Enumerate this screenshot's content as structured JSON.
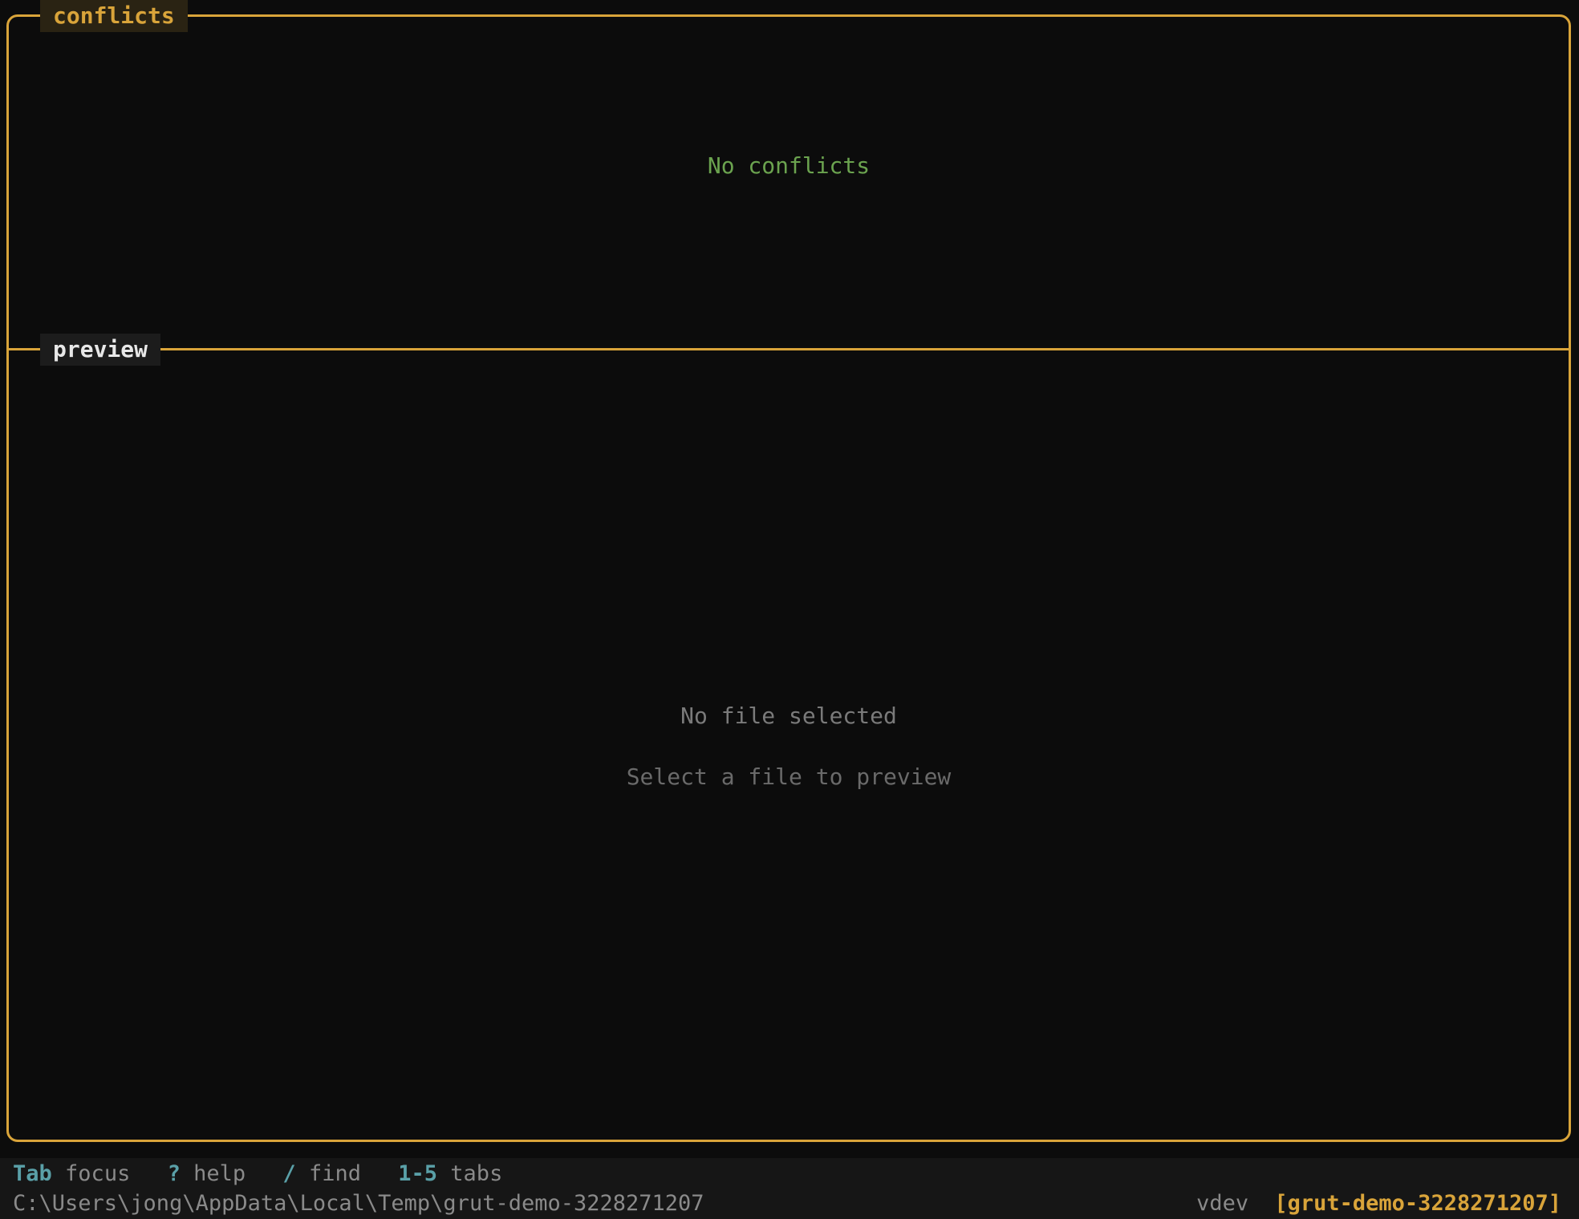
{
  "conflicts_panel": {
    "title": "conflicts",
    "empty_message": "No conflicts"
  },
  "preview_panel": {
    "title": "preview",
    "empty_message": "No file selected",
    "hint": "Select a file to preview"
  },
  "keybar": {
    "items": [
      {
        "key": "Tab",
        "desc": "focus"
      },
      {
        "key": "?",
        "desc": "help"
      },
      {
        "key": "/",
        "desc": "find"
      },
      {
        "key": "1-5",
        "desc": "tabs"
      }
    ]
  },
  "statusbar": {
    "path": "C:\\Users\\jong\\AppData\\Local\\Temp\\grut-demo-3228271207",
    "version": "vdev",
    "branch": "[grut-demo-3228271207]"
  },
  "colors": {
    "accent": "#d9a43a",
    "success": "#6ba34f",
    "key": "#5aa0a8",
    "muted": "#8a8a8a",
    "background": "#0c0c0c"
  }
}
